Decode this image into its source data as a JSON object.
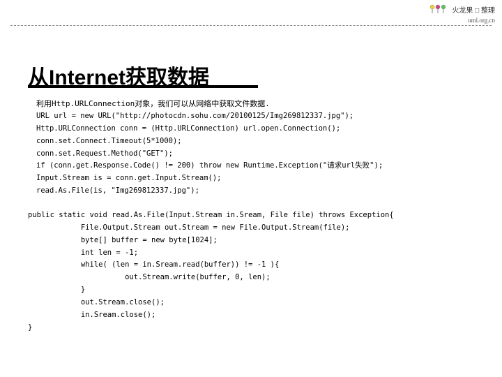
{
  "watermark": {
    "brand": "火龙果 □ 整理",
    "url": "uml.org.cn"
  },
  "title": "从Internet获取数据",
  "intro": "利用Http.URLConnection对象，我们可以从网络中获取文件数据.",
  "code1": "URL url = new URL(\"http://photocdn.sohu.com/20100125/Img269812337.jpg\");\nHttp.URLConnection conn = (Http.URLConnection) url.open.Connection();\nconn.set.Connect.Timeout(5*1000);\nconn.set.Request.Method(\"GET\");\nif (conn.get.Response.Code() != 200) throw new Runtime.Exception(\"请求url失败\");\nInput.Stream is = conn.get.Input.Stream();\nread.As.File(is, \"Img269812337.jpg\");",
  "code2": "public static void read.As.File(Input.Stream in.Sream, File file) throws Exception{\n            File.Output.Stream out.Stream = new File.Output.Stream(file);\n            byte[] buffer = new byte[1024];\n            int len = -1;\n            while( (len = in.Sream.read(buffer)) != -1 ){\n                      out.Stream.write(buffer, 0, len);\n            }\n            out.Stream.close();\n            in.Sream.close();\n}"
}
